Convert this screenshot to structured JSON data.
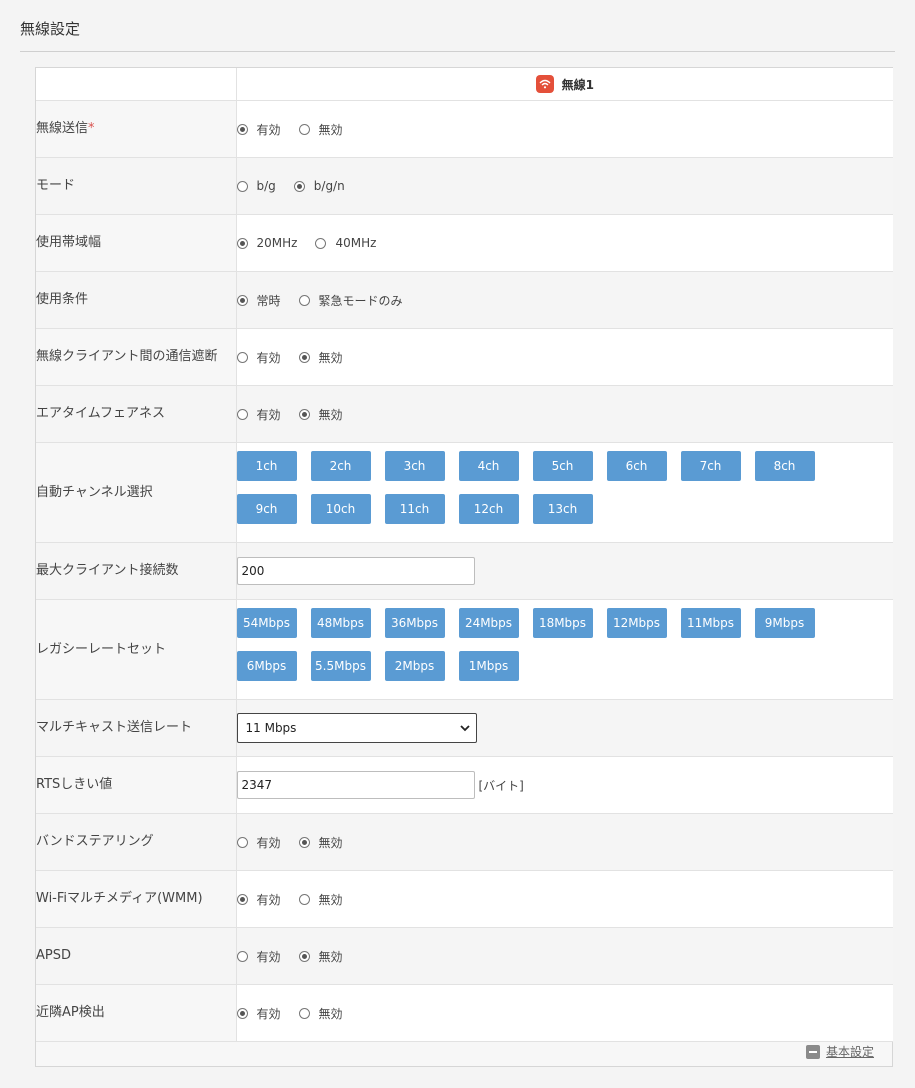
{
  "page": {
    "title": "無線設定"
  },
  "table": {
    "column_header": "無線1"
  },
  "rows": {
    "tx": {
      "label": "無線送信",
      "required_mark": "*",
      "options": [
        "有効",
        "無効"
      ],
      "selected": 0
    },
    "mode": {
      "label": "モード",
      "options": [
        "b/g",
        "b/g/n"
      ],
      "selected": 1
    },
    "bandwidth": {
      "label": "使用帯域幅",
      "options": [
        "20MHz",
        "40MHz"
      ],
      "selected": 0
    },
    "condition": {
      "label": "使用条件",
      "options": [
        "常時",
        "緊急モードのみ"
      ],
      "selected": 0
    },
    "isolation": {
      "label": "無線クライアント間の通信遮断",
      "options": [
        "有効",
        "無効"
      ],
      "selected": 1
    },
    "airtime": {
      "label": "エアタイムフェアネス",
      "options": [
        "有効",
        "無効"
      ],
      "selected": 1
    },
    "auto_channel": {
      "label": "自動チャンネル選択",
      "channels": [
        "1ch",
        "2ch",
        "3ch",
        "4ch",
        "5ch",
        "6ch",
        "7ch",
        "8ch",
        "9ch",
        "10ch",
        "11ch",
        "12ch",
        "13ch"
      ]
    },
    "max_clients": {
      "label": "最大クライアント接続数",
      "value": "200"
    },
    "legacy_rates": {
      "label": "レガシーレートセット",
      "rates": [
        "54Mbps",
        "48Mbps",
        "36Mbps",
        "24Mbps",
        "18Mbps",
        "12Mbps",
        "11Mbps",
        "9Mbps",
        "6Mbps",
        "5.5Mbps",
        "2Mbps",
        "1Mbps"
      ]
    },
    "multicast": {
      "label": "マルチキャスト送信レート",
      "selected_value": "11 Mbps"
    },
    "rts": {
      "label": "RTSしきい値",
      "value": "2347",
      "unit": "[バイト]"
    },
    "band_steering": {
      "label": "バンドステアリング",
      "options": [
        "有効",
        "無効"
      ],
      "selected": 1
    },
    "wmm": {
      "label": "Wi-Fiマルチメディア(WMM)",
      "options": [
        "有効",
        "無効"
      ],
      "selected": 0
    },
    "apsd": {
      "label": "APSD",
      "options": [
        "有効",
        "無効"
      ],
      "selected": 1
    },
    "neighbor_ap": {
      "label": "近隣AP検出",
      "options": [
        "有効",
        "無効"
      ],
      "selected": 0
    }
  },
  "footer": {
    "link": "基本設定"
  }
}
